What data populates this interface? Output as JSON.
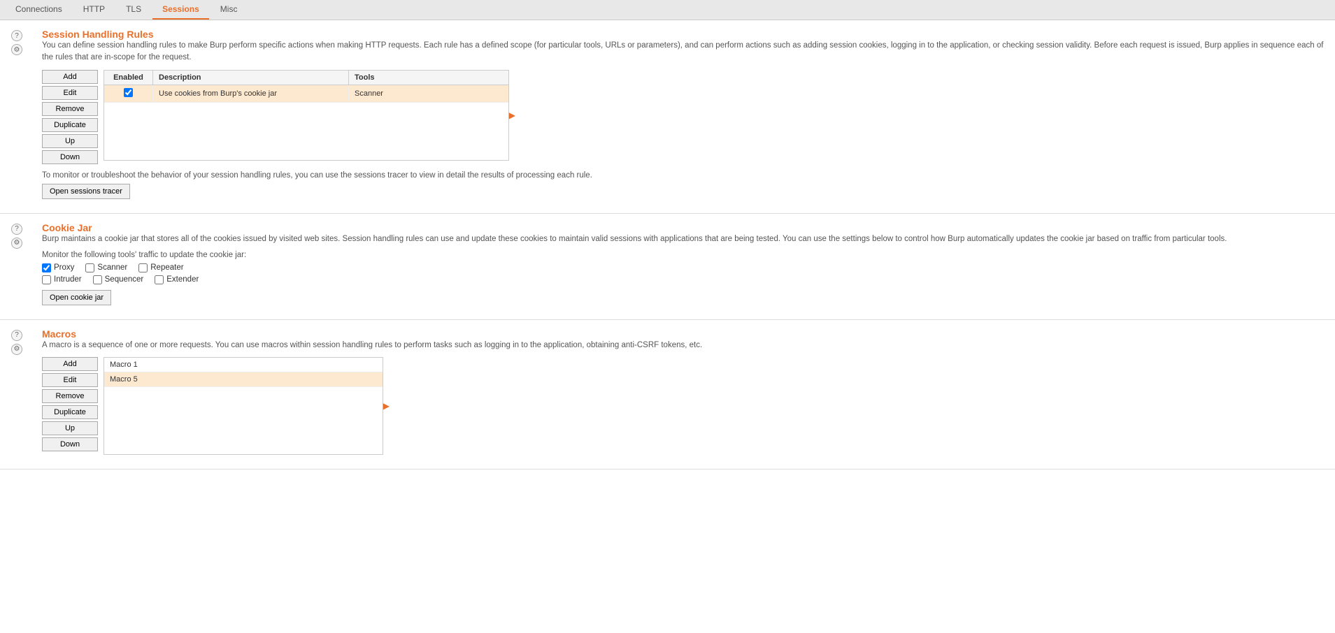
{
  "tabs": [
    {
      "label": "Connections",
      "active": false
    },
    {
      "label": "HTTP",
      "active": false
    },
    {
      "label": "TLS",
      "active": false
    },
    {
      "label": "Sessions",
      "active": true
    },
    {
      "label": "Misc",
      "active": false
    }
  ],
  "session_handling": {
    "title": "Session Handling Rules",
    "description": "You can define session handling rules to make Burp perform specific actions when making HTTP requests. Each rule has a defined scope (for particular tools, URLs or parameters), and can perform actions such as adding session cookies, logging in to the application, or checking session validity. Before each request is issued, Burp applies in sequence each of the rules that are in-scope for the request.",
    "buttons": [
      "Add",
      "Edit",
      "Remove",
      "Duplicate",
      "Up",
      "Down"
    ],
    "table": {
      "columns": [
        "Enabled",
        "Description",
        "Tools"
      ],
      "rows": [
        {
          "enabled": true,
          "description": "Use cookies from Burp's cookie jar",
          "tools": "Scanner",
          "selected": true
        }
      ]
    },
    "tracer_text": "To monitor or troubleshoot the behavior of your session handling rules, you can use the sessions tracer to view in detail the results of processing each rule.",
    "tracer_button": "Open sessions tracer"
  },
  "cookie_jar": {
    "title": "Cookie Jar",
    "description": "Burp maintains a cookie jar that stores all of the cookies issued by visited web sites. Session handling rules can use and update these cookies to maintain valid sessions with applications that are being tested. You can use the settings below to control how Burp automatically updates the cookie jar based on traffic from particular tools.",
    "monitor_label": "Monitor the following tools' traffic to update the cookie jar:",
    "checkboxes": [
      {
        "label": "Proxy",
        "checked": true,
        "row": 1
      },
      {
        "label": "Scanner",
        "checked": false,
        "row": 1
      },
      {
        "label": "Repeater",
        "checked": false,
        "row": 1
      },
      {
        "label": "Intruder",
        "checked": false,
        "row": 2
      },
      {
        "label": "Sequencer",
        "checked": false,
        "row": 2
      },
      {
        "label": "Extender",
        "checked": false,
        "row": 2
      }
    ],
    "button": "Open cookie jar"
  },
  "macros": {
    "title": "Macros",
    "description": "A macro is a sequence of one or more requests. You can use macros within session handling rules to perform tasks such as logging in to the application, obtaining anti-CSRF tokens, etc.",
    "buttons": [
      "Add",
      "Edit",
      "Remove",
      "Duplicate",
      "Up",
      "Down"
    ],
    "items": [
      {
        "label": "Macro 1",
        "selected": false
      },
      {
        "label": "Macro 5",
        "selected": true
      }
    ]
  }
}
